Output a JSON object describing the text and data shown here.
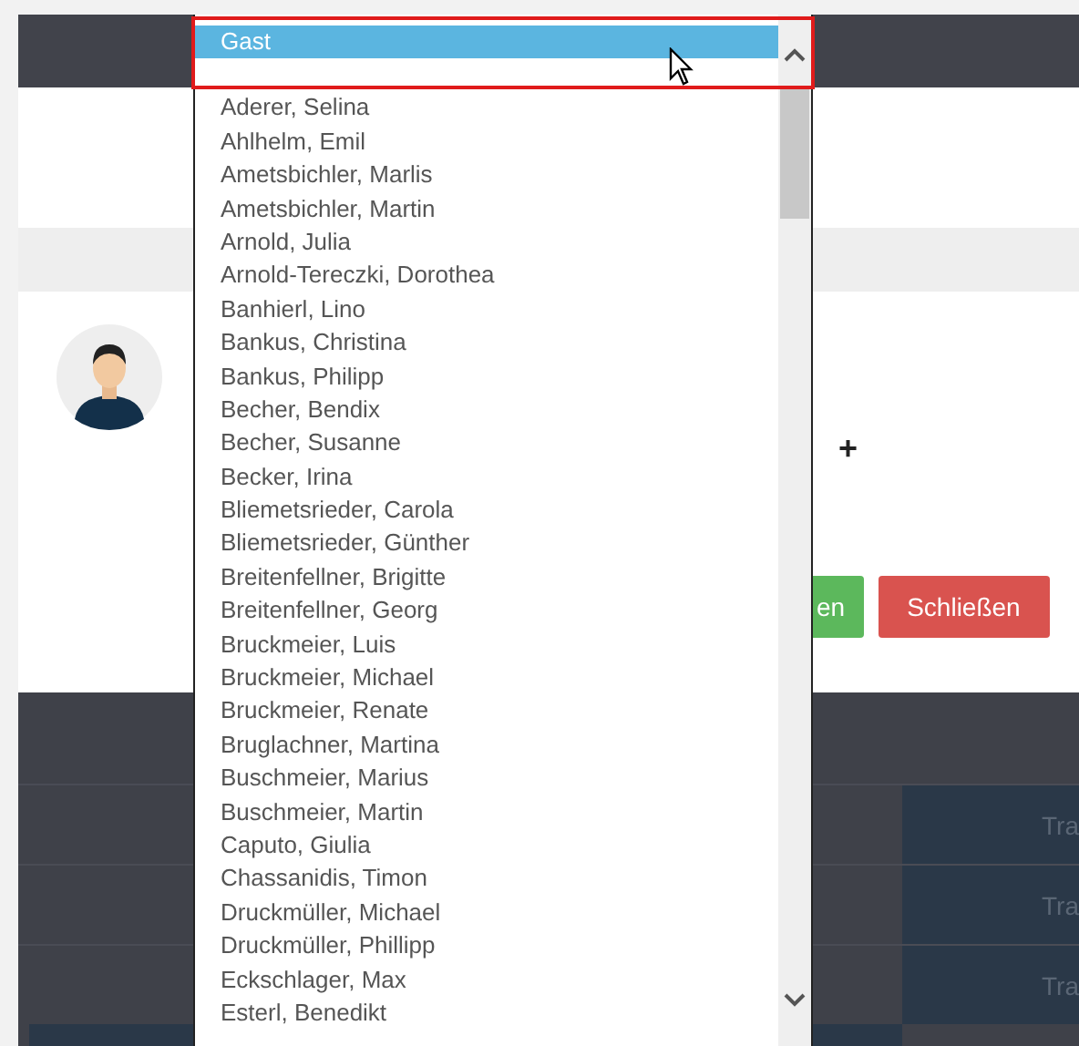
{
  "dialog": {
    "buttons": [
      {
        "label": "en",
        "kind": "save"
      },
      {
        "label": "Schließen",
        "kind": "close"
      }
    ],
    "add_symbol": "+"
  },
  "table": {
    "cells": [
      "Tra",
      "Tra",
      "Tra"
    ]
  },
  "dropdown": {
    "options": [
      {
        "label": "Gast",
        "selected": true
      },
      {
        "label": "Aderer, Selina",
        "selected": false
      },
      {
        "label": "Ahlhelm, Emil",
        "selected": false
      },
      {
        "label": "Ametsbichler, Marlis",
        "selected": false
      },
      {
        "label": "Ametsbichler, Martin",
        "selected": false
      },
      {
        "label": "Arnold, Julia",
        "selected": false
      },
      {
        "label": "Arnold-Tereczki, Dorothea",
        "selected": false
      },
      {
        "label": "Banhierl, Lino",
        "selected": false
      },
      {
        "label": "Bankus, Christina",
        "selected": false
      },
      {
        "label": "Bankus, Philipp",
        "selected": false
      },
      {
        "label": "Becher, Bendix",
        "selected": false
      },
      {
        "label": "Becher, Susanne",
        "selected": false
      },
      {
        "label": "Becker, Irina",
        "selected": false
      },
      {
        "label": "Bliemetsrieder, Carola",
        "selected": false
      },
      {
        "label": "Bliemetsrieder, Günther",
        "selected": false
      },
      {
        "label": "Breitenfellner, Brigitte",
        "selected": false
      },
      {
        "label": "Breitenfellner, Georg",
        "selected": false
      },
      {
        "label": "Bruckmeier, Luis",
        "selected": false
      },
      {
        "label": "Bruckmeier, Michael",
        "selected": false
      },
      {
        "label": "Bruckmeier, Renate",
        "selected": false
      },
      {
        "label": "Bruglachner, Martina",
        "selected": false
      },
      {
        "label": "Buschmeier, Marius",
        "selected": false
      },
      {
        "label": "Buschmeier, Martin",
        "selected": false
      },
      {
        "label": "Caputo, Giulia",
        "selected": false
      },
      {
        "label": "Chassanidis, Timon",
        "selected": false
      },
      {
        "label": "Druckmüller, Michael",
        "selected": false
      },
      {
        "label": "Druckmüller, Phillipp",
        "selected": false
      },
      {
        "label": "Eckschlager, Max",
        "selected": false
      },
      {
        "label": "Esterl, Benedikt",
        "selected": false
      }
    ]
  }
}
